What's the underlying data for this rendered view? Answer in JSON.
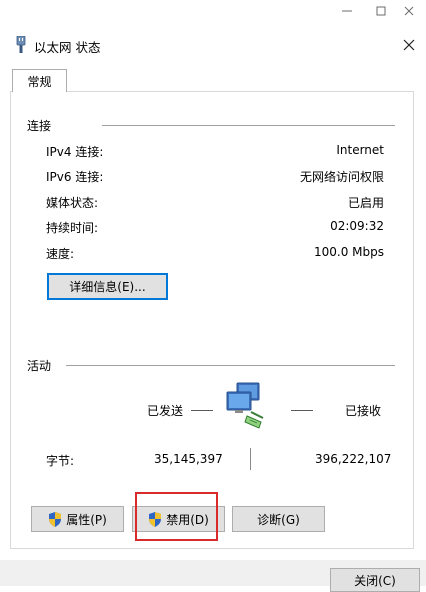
{
  "dialog": {
    "title": "以太网 状态"
  },
  "tabs": [
    {
      "label": "常规"
    }
  ],
  "connection": {
    "group_label": "连接",
    "rows": [
      {
        "label": "IPv4 连接:",
        "value": "Internet"
      },
      {
        "label": "IPv6 连接:",
        "value": "无网络访问权限"
      },
      {
        "label": "媒体状态:",
        "value": "已启用"
      },
      {
        "label": "持续时间:",
        "value": "02:09:32"
      },
      {
        "label": "速度:",
        "value": "100.0 Mbps"
      }
    ],
    "details_button": "详细信息(E)..."
  },
  "activity": {
    "group_label": "活动",
    "sent_label": "已发送",
    "received_label": "已接收",
    "bytes_label": "字节:",
    "bytes_sent": "35,145,397",
    "bytes_received": "396,222,107"
  },
  "buttons": {
    "properties": "属性(P)",
    "disable": "禁用(D)",
    "diagnose": "诊断(G)",
    "close": "关闭(C)"
  },
  "colors": {
    "accent_border": "#0078d7",
    "highlight_box": "#d92b2b",
    "button_face": "#e1e1e1"
  },
  "icons": [
    "minimize-icon",
    "maximize-icon",
    "window-close-icon",
    "ethernet-plug-icon",
    "dialog-close-icon",
    "network-computers-icon",
    "uac-shield-icon"
  ]
}
